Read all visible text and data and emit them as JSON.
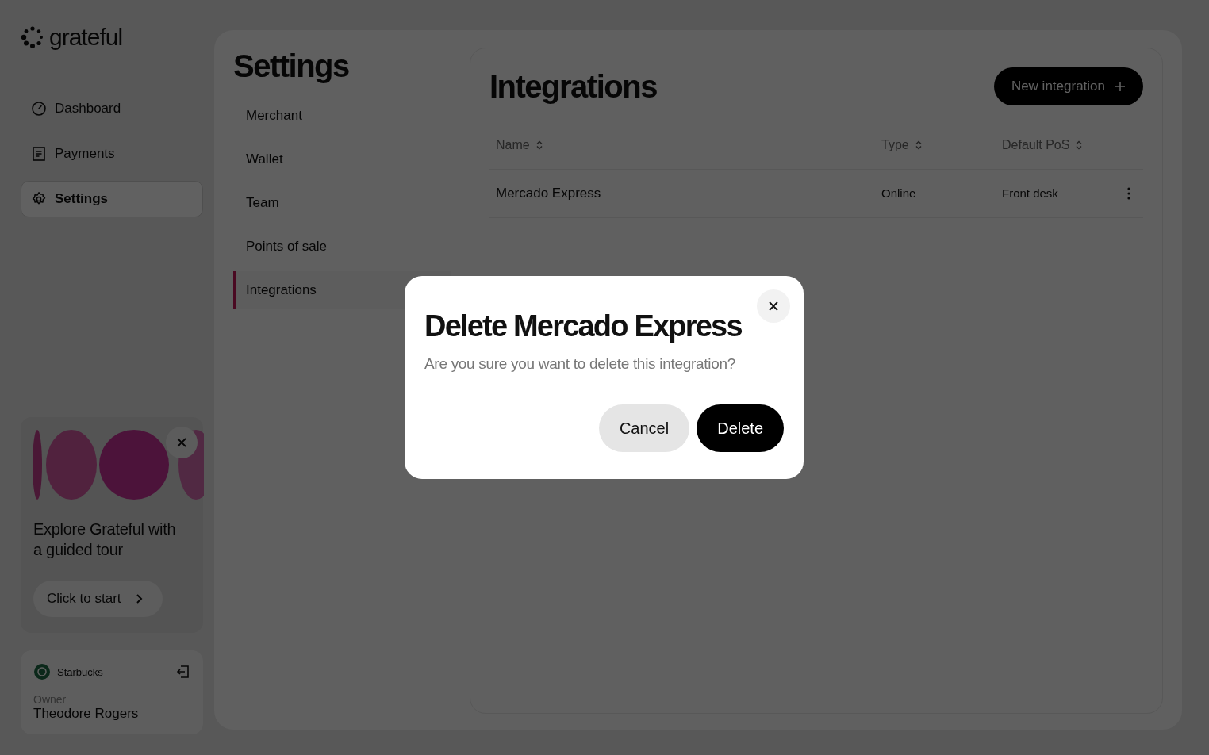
{
  "brand": {
    "name": "grateful"
  },
  "nav": [
    {
      "label": "Dashboard",
      "selected": false
    },
    {
      "label": "Payments",
      "selected": false
    },
    {
      "label": "Settings",
      "selected": true
    }
  ],
  "promo": {
    "title": "Explore Grateful with a guided tour",
    "button": "Click to start"
  },
  "account": {
    "company": "Starbucks",
    "role": "Owner",
    "name": "Theodore Rogers"
  },
  "settings": {
    "title": "Settings",
    "items": [
      {
        "label": "Merchant",
        "selected": false
      },
      {
        "label": "Wallet",
        "selected": false
      },
      {
        "label": "Team",
        "selected": false
      },
      {
        "label": "Points of sale",
        "selected": false
      },
      {
        "label": "Integrations",
        "selected": true
      }
    ]
  },
  "integrations": {
    "title": "Integrations",
    "new_button": "New integration",
    "columns": [
      "Name",
      "Type",
      "Default PoS"
    ],
    "rows": [
      {
        "name": "Mercado Express",
        "type": "Online",
        "pos": "Front desk"
      }
    ]
  },
  "dialog": {
    "title": "Delete Mercado Express",
    "message": "Are you sure you want to delete this integration?",
    "cancel": "Cancel",
    "confirm": "Delete"
  }
}
